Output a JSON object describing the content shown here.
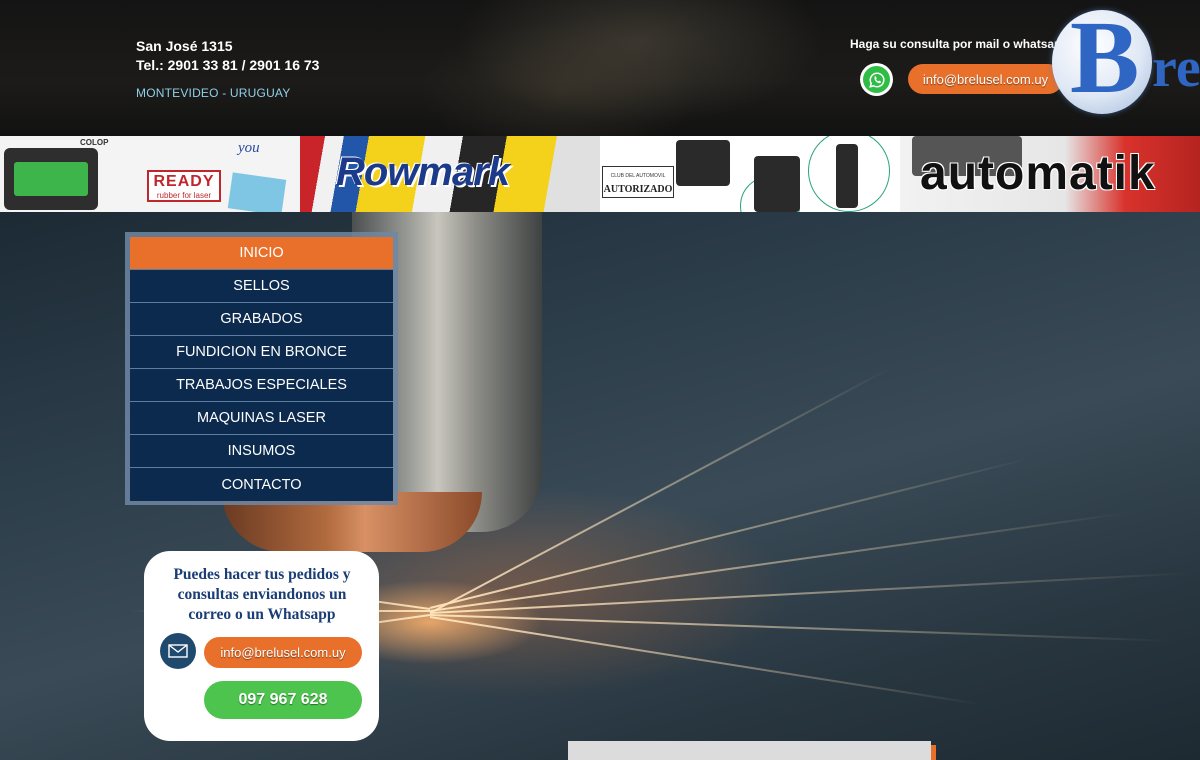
{
  "header": {
    "address_line1": "San José 1315",
    "address_line2": "Tel.: 2901 33 81 / 2901 16 73",
    "city": "MONTEVIDEO - URUGUAY",
    "consulta_label": "Haga su consulta por mail o whatsapp",
    "email": "info@brelusel.com.uy",
    "logo_letter": "B",
    "logo_rest": "re"
  },
  "banner": {
    "colop": "COLOP",
    "ready": "READY",
    "ready_sub": "rubber for laser",
    "you": "you",
    "rowmark": "Rowmark",
    "autorizado_small": "CLUB DEL AUTOMOVIL",
    "autorizado": "AUTORIZADO",
    "automatik": "automatik"
  },
  "nav": {
    "items": [
      {
        "label": "INICIO"
      },
      {
        "label": "SELLOS"
      },
      {
        "label": "GRABADOS"
      },
      {
        "label": "FUNDICION EN BRONCE"
      },
      {
        "label": "TRABAJOS ESPECIALES"
      },
      {
        "label": "MAQUINAS LASER"
      },
      {
        "label": "INSUMOS"
      },
      {
        "label": "CONTACTO"
      }
    ],
    "active_index": 0
  },
  "contact_card": {
    "title": "Puedes hacer tus pedidos y consultas enviandonos un correo o un Whatsapp",
    "email": "info@brelusel.com.uy",
    "phone": "097 967 628"
  },
  "colors": {
    "accent_orange": "#e8702a",
    "nav_blue": "#0b2a4e",
    "whatsapp_green": "#4cc44d",
    "brand_blue": "#2f66c4"
  },
  "icons": {
    "whatsapp": "whatsapp-icon",
    "envelope": "envelope-icon"
  }
}
